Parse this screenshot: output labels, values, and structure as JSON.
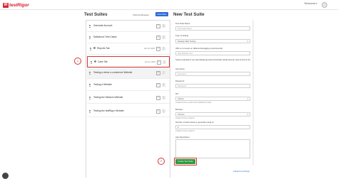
{
  "brand": {
    "name": "testRigor",
    "mark": "tR"
  },
  "topbar": {
    "resources_label": "Resources ▾"
  },
  "left": {
    "title": "Test Suites",
    "link_label": "Chat and Request",
    "new_folder_label": "New folder",
    "suites": [
      {
        "name": "Generate Account",
        "date": "",
        "count": "1"
      },
      {
        "name": "Salesforce Test Cases",
        "date": "",
        "count": "2"
      },
      {
        "name": "Reports Tab",
        "date": "Jan 22, 2024",
        "count": "1"
      },
      {
        "name": "Case Tab",
        "date": "Jan 21, 2024",
        "count": "1"
      },
      {
        "name": "Testing a demo e-commerce Website",
        "date": "",
        "count": "1"
      },
      {
        "name": "Testing a Website",
        "date": "",
        "count": "1"
      },
      {
        "name": "Testing the Medium Website",
        "date": "",
        "count": "1"
      },
      {
        "name": "Testing the testRigor Website",
        "date": "",
        "count": "1"
      }
    ]
  },
  "right": {
    "title": "New Test Suite",
    "fields": {
      "name_label": "Test Suite Name",
      "name_placeholder": "Test Suite Name",
      "type_label": "Type of testing",
      "type_value": "Desktop Web Testing",
      "url_label": "URL to run tests on (affects debugging environments)",
      "url_placeholder": "http://testsite.com",
      "login_label": "Testing credentials for your automatically generated functionality, tabular steps are used as input for the",
      "username_label": "Username",
      "username_placeholder": "Username",
      "password_label": "Password",
      "password_placeholder": "Password",
      "os_label": "OS",
      "os_value": "Ubuntu",
      "os_note": "Limited for free version and unlimited for paid",
      "browser_label": "Browser",
      "browser_value": "Chrome",
      "browser_note": "Limited for free versions",
      "number_label": "Number of tests cases to generate using AI",
      "number_value": "0",
      "number_note": "Limited for free versions",
      "description_label": "App Description"
    },
    "create_label": "Create Test Suite",
    "advanced_label": "Advanced settings"
  },
  "steps": {
    "one": "1",
    "two": "2"
  },
  "colors": {
    "brand_red": "#d9232e",
    "primary_blue": "#2e6bd6",
    "create_green": "#2b9a3e",
    "highlight_red": "#d63232"
  }
}
